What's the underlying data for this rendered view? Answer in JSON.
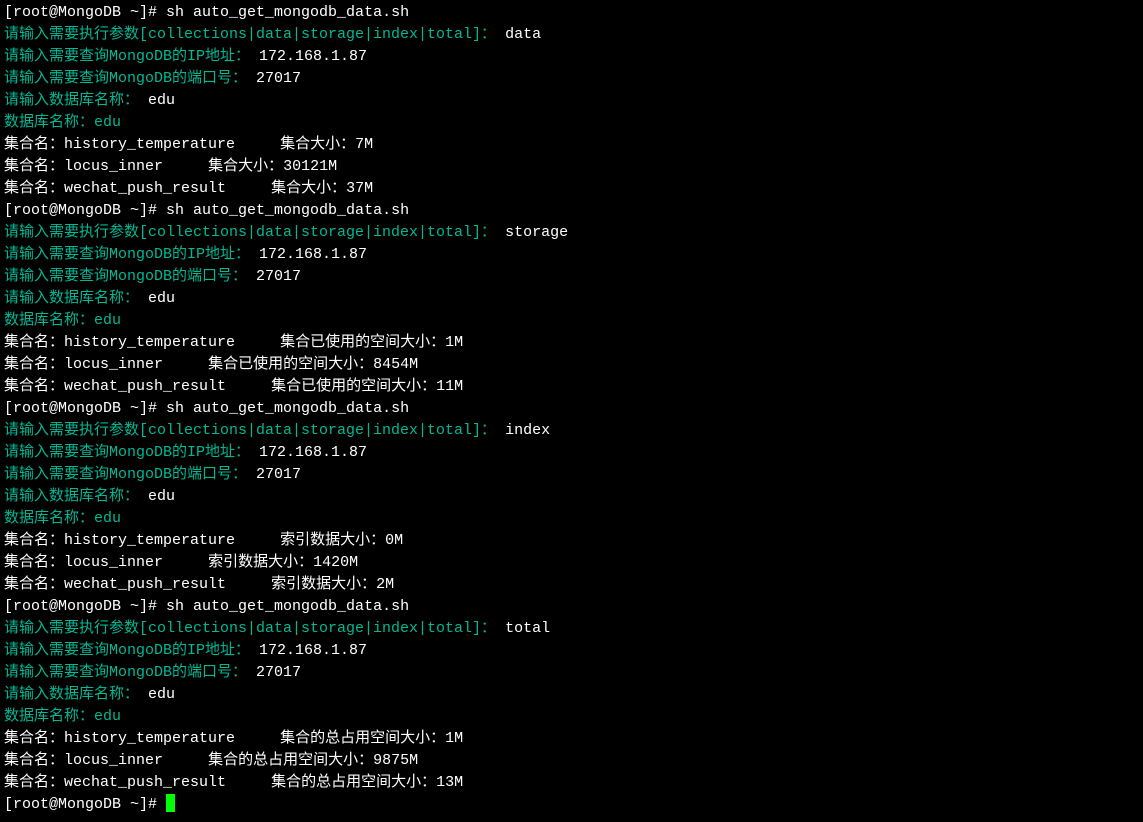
{
  "prompt": "[root@MongoDB ~]# ",
  "command": "sh auto_get_mongodb_data.sh",
  "prompts_green": {
    "param": "请输入需要执行参数[collections|data|storage|index|total]：",
    "ip": "请输入需要查询MongoDB的IP地址：",
    "port": "请输入需要查询MongoDB的端口号：",
    "dbname": "请输入数据库名称：",
    "dbtitle": "数据库名称：",
    "dbval": "edu"
  },
  "inputs": {
    "ip": "172.168.1.87",
    "port": "27017",
    "db": "edu"
  },
  "runs": [
    {
      "param": "data",
      "label": "集合大小：",
      "rows": [
        {
          "name": "history_temperature",
          "pad": "     ",
          "val": "7M"
        },
        {
          "name": "locus_inner",
          "pad": "     ",
          "val": "30121M"
        },
        {
          "name": "wechat_push_result",
          "pad": "     ",
          "val": "37M"
        }
      ]
    },
    {
      "param": "storage",
      "label": "集合已使用的空间大小：",
      "rows": [
        {
          "name": "history_temperature",
          "pad": "     ",
          "val": "1M"
        },
        {
          "name": "locus_inner",
          "pad": "     ",
          "val": "8454M"
        },
        {
          "name": "wechat_push_result",
          "pad": "     ",
          "val": "11M"
        }
      ]
    },
    {
      "param": "index",
      "label": "索引数据大小：",
      "rows": [
        {
          "name": "history_temperature",
          "pad": "     ",
          "val": "0M"
        },
        {
          "name": "locus_inner",
          "pad": "     ",
          "val": "1420M"
        },
        {
          "name": "wechat_push_result",
          "pad": "     ",
          "val": "2M"
        }
      ]
    },
    {
      "param": "total",
      "label": "集合的总占用空间大小：",
      "rows": [
        {
          "name": "history_temperature",
          "pad": "     ",
          "val": "1M"
        },
        {
          "name": "locus_inner",
          "pad": "     ",
          "val": "9875M"
        },
        {
          "name": "wechat_push_result",
          "pad": "     ",
          "val": "13M"
        }
      ]
    }
  ],
  "coll_prefix": "集合名："
}
